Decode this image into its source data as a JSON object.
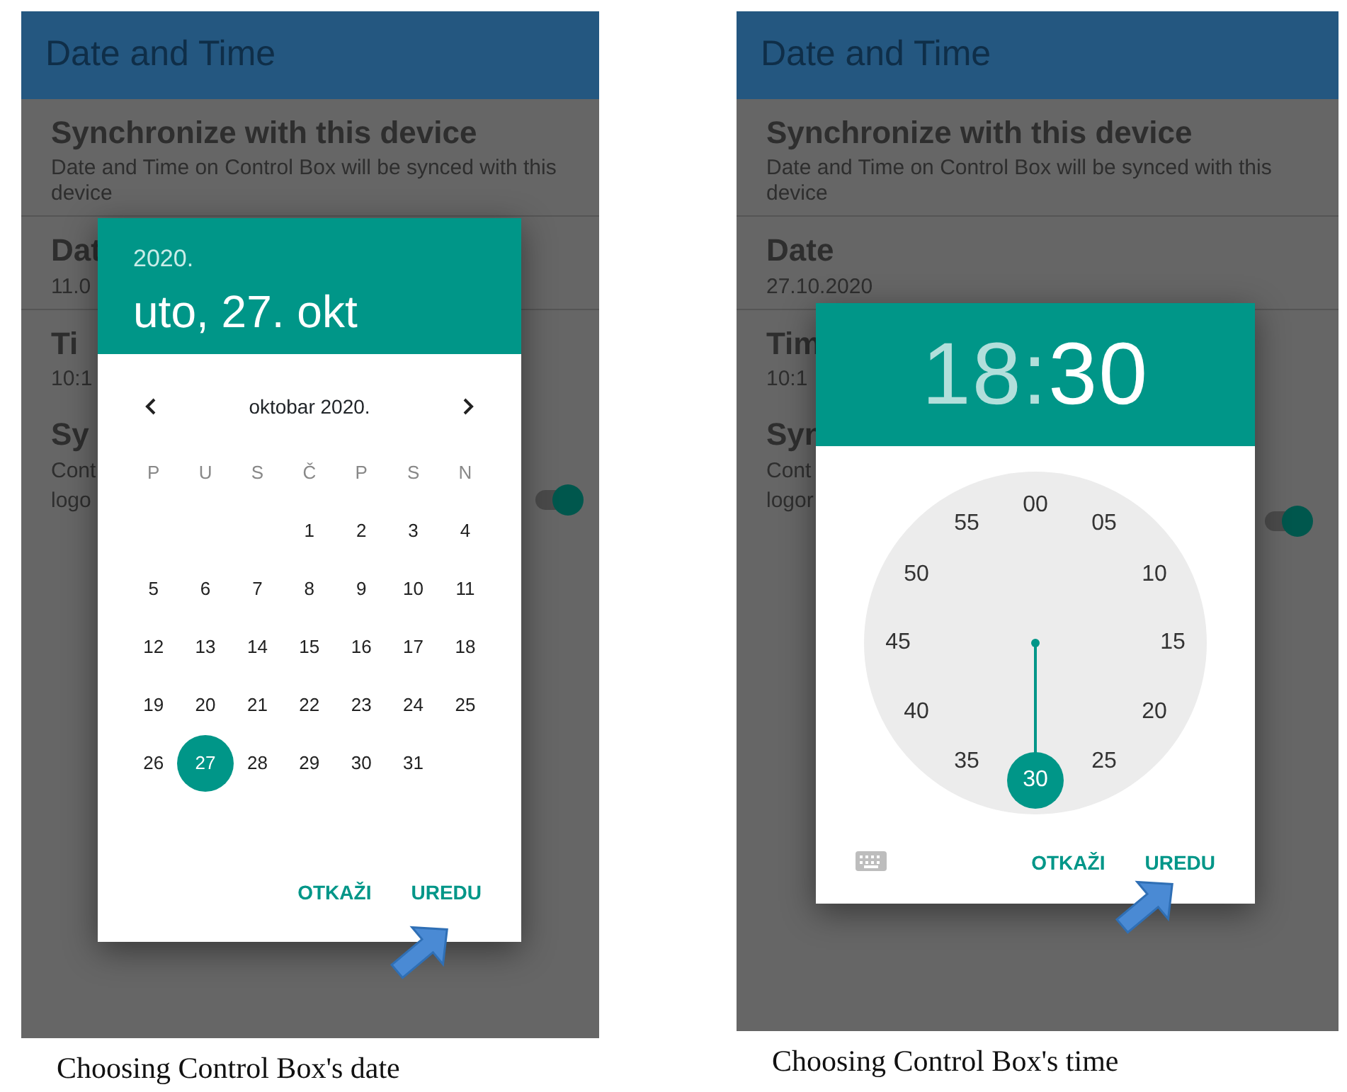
{
  "screens": [
    {
      "app_bar": {
        "title": "Date and Time"
      },
      "settings": [
        {
          "title": "Synchronize with this device",
          "lines": [
            "Date and Time on Control Box will be synced with this device"
          ],
          "divider": true
        },
        {
          "title": "Dat",
          "lines": [
            "11.0"
          ],
          "divider": true
        },
        {
          "title": "Ti",
          "lines": [
            "10:1"
          ],
          "divider": false
        },
        {
          "title": "Sy",
          "lines": [
            "Cont",
            "logo"
          ],
          "divider": false,
          "switch_on": true
        }
      ],
      "dialog": {
        "kind": "date",
        "year": "2020.",
        "date": "uto, 27. okt",
        "month": "oktobar 2020.",
        "weekdays": [
          "P",
          "U",
          "S",
          "Č",
          "P",
          "S",
          "N"
        ],
        "weeks": [
          [
            {
              "label": "1",
              "selected": false
            },
            {
              "label": "2",
              "selected": false
            },
            {
              "label": "3",
              "selected": false
            },
            {
              "label": "4",
              "selected": false
            }
          ],
          [
            {
              "label": "5",
              "selected": false
            },
            {
              "label": "6",
              "selected": false
            },
            {
              "label": "7",
              "selected": false
            },
            {
              "label": "8",
              "selected": false
            },
            {
              "label": "9",
              "selected": false
            },
            {
              "label": "10",
              "selected": false
            },
            {
              "label": "11",
              "selected": false
            }
          ],
          [
            {
              "label": "12",
              "selected": false
            },
            {
              "label": "13",
              "selected": false
            },
            {
              "label": "14",
              "selected": false
            },
            {
              "label": "15",
              "selected": false
            },
            {
              "label": "16",
              "selected": false
            },
            {
              "label": "17",
              "selected": false
            },
            {
              "label": "18",
              "selected": false
            }
          ],
          [
            {
              "label": "19",
              "selected": false
            },
            {
              "label": "20",
              "selected": false
            },
            {
              "label": "21",
              "selected": false
            },
            {
              "label": "22",
              "selected": false
            },
            {
              "label": "23",
              "selected": false
            },
            {
              "label": "24",
              "selected": false
            },
            {
              "label": "25",
              "selected": false
            }
          ],
          [
            {
              "label": "26",
              "selected": false
            },
            {
              "label": "27",
              "selected": true
            },
            {
              "label": "28",
              "selected": false
            },
            {
              "label": "29",
              "selected": false
            },
            {
              "label": "30",
              "selected": false
            },
            {
              "label": "31",
              "selected": false
            }
          ]
        ],
        "buttons": [
          "OTKAŽI",
          "UREDU"
        ]
      },
      "caption": "Choosing Control Box's date"
    },
    {
      "app_bar": {
        "title": "Date and Time"
      },
      "settings": [
        {
          "title": "Synchronize with this device",
          "lines": [
            "Date and Time on Control Box will be synced with this device"
          ],
          "divider": true
        },
        {
          "title": "Date",
          "lines": [
            "27.10.2020"
          ],
          "divider": true
        },
        {
          "title": "Tim",
          "lines": [
            "10:1"
          ],
          "divider": false
        },
        {
          "title": "Syn",
          "lines": [
            "Cont",
            "logor"
          ],
          "divider": false,
          "switch_on": true
        }
      ],
      "dialog": {
        "kind": "time",
        "hour": {
          "label": "18",
          "selected": false
        },
        "separator": ":",
        "minute": {
          "label": "30",
          "selected": true
        },
        "dial": [
          {
            "label": "00",
            "selected": false
          },
          {
            "label": "05",
            "selected": false
          },
          {
            "label": "10",
            "selected": false
          },
          {
            "label": "15",
            "selected": false
          },
          {
            "label": "20",
            "selected": false
          },
          {
            "label": "25",
            "selected": false
          },
          {
            "label": "30",
            "selected": true
          },
          {
            "label": "35",
            "selected": false
          },
          {
            "label": "40",
            "selected": false
          },
          {
            "label": "45",
            "selected": false
          },
          {
            "label": "50",
            "selected": false
          },
          {
            "label": "55",
            "selected": false
          }
        ],
        "buttons": [
          "OTKAŽI",
          "UREDU"
        ]
      },
      "caption": "Choosing Control Box's time"
    }
  ]
}
